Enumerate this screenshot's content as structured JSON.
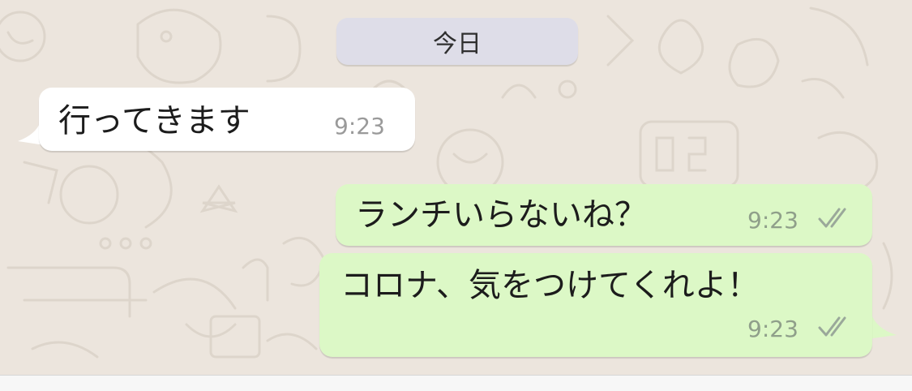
{
  "chat": {
    "date_badge": "今日",
    "messages": [
      {
        "direction": "incoming",
        "text": "行ってきます",
        "time": "9:23"
      },
      {
        "direction": "outgoing",
        "text": "ランチいらないね？",
        "time": "9:23",
        "status": "read-double-check"
      },
      {
        "direction": "outgoing",
        "text": "コロナ、気をつけてくれよ！",
        "time": "9:23",
        "status": "read-double-check"
      }
    ]
  },
  "colors": {
    "background": "#ece5dd",
    "incoming_bubble": "#ffffff",
    "outgoing_bubble": "#dcf8c6",
    "date_badge": "#dedde8",
    "tick": "#9aa89a"
  },
  "icons": {
    "read_status": "double-check-icon"
  }
}
